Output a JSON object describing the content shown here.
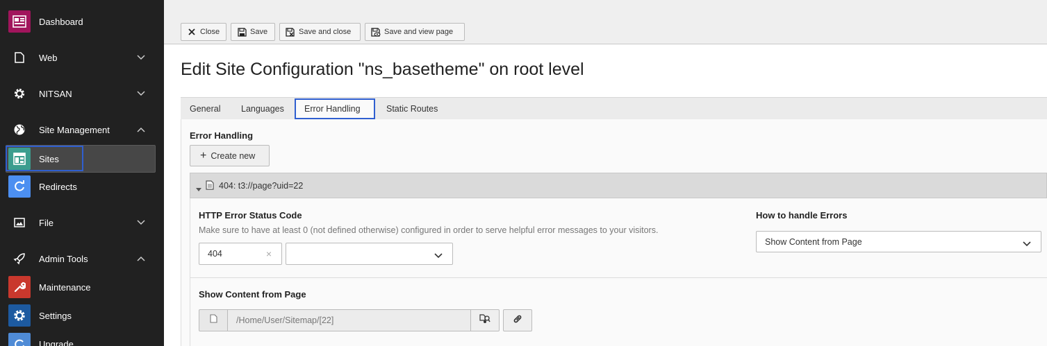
{
  "sidebar": {
    "items": [
      {
        "label": "Dashboard",
        "icon": "dashboard-icon",
        "color": "#a1155c"
      },
      {
        "label": "Web",
        "icon": "page-icon",
        "expanded": false
      },
      {
        "label": "NITSAN",
        "icon": "gear-icon",
        "expanded": false
      },
      {
        "label": "Site Management",
        "icon": "globe-icon",
        "expanded": true
      },
      {
        "label": "Sites",
        "icon": "sites-icon",
        "color": "#3c9d8e",
        "active": true
      },
      {
        "label": "Redirects",
        "icon": "redirects-icon",
        "color": "#4c8ff1"
      },
      {
        "label": "File",
        "icon": "image-icon",
        "expanded": false
      },
      {
        "label": "Admin Tools",
        "icon": "rocket-icon",
        "expanded": true
      },
      {
        "label": "Maintenance",
        "icon": "wrench-icon",
        "color": "#c9382d"
      },
      {
        "label": "Settings",
        "icon": "settings-gear-icon",
        "color": "#1d5aa0"
      },
      {
        "label": "Upgrade",
        "icon": "upgrade-icon",
        "color": "#4f8bd6"
      }
    ]
  },
  "toolbar": {
    "close_label": "Close",
    "save_label": "Save",
    "save_close_label": "Save and close",
    "save_view_label": "Save and view page"
  },
  "page": {
    "title": "Edit Site Configuration \"ns_basetheme\" on root level"
  },
  "tabs": [
    {
      "label": "General"
    },
    {
      "label": "Languages"
    },
    {
      "label": "Error Handling",
      "active": true
    },
    {
      "label": "Static Routes"
    }
  ],
  "error_handling": {
    "heading": "Error Handling",
    "create_new_label": "Create new",
    "record": {
      "title": "404: t3://page?uid=22"
    },
    "status_code": {
      "label": "HTTP Error Status Code",
      "description": "Make sure to have at least 0 (not defined otherwise) configured in order to serve helpful error messages to your visitors.",
      "value": "404",
      "select_value": ""
    },
    "handler": {
      "label": "How to handle Errors",
      "value": "Show Content from Page"
    },
    "content_page": {
      "label": "Show Content from Page",
      "value": "/Home/User/Sitemap/[22]"
    }
  },
  "colors": {
    "accent": "#2f5fd0",
    "sidebar_bg": "#212121"
  }
}
